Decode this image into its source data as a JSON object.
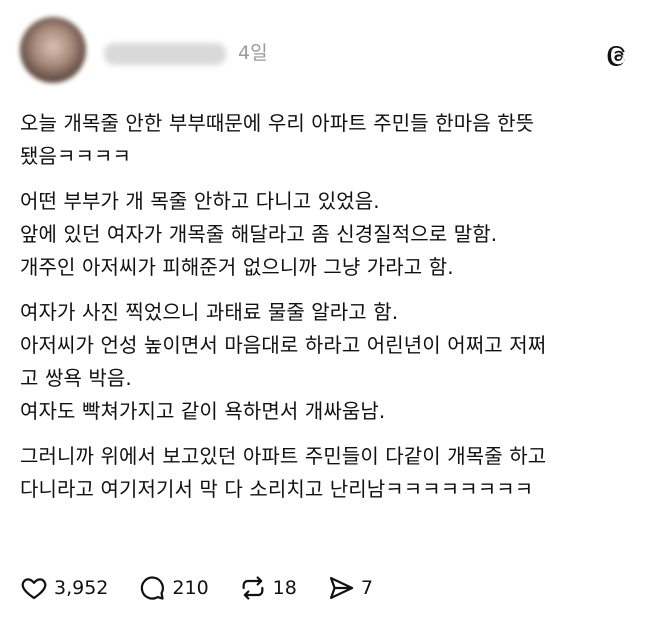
{
  "post": {
    "username": "psleh_ping",
    "time": "4일",
    "paragraphs": [
      [
        "오늘 개목줄 안한 부부때문에 우리 아파트 주민들 한마음 한뜻",
        "됐음ㅋㅋㅋㅋ"
      ],
      [
        "어떤 부부가 개 목줄 안하고 다니고 있었음.",
        "앞에 있던 여자가 개목줄 해달라고 좀 신경질적으로 말함.",
        "개주인 아저씨가 피해준거 없으니까 그냥 가라고 함."
      ],
      [
        "여자가 사진 찍었으니 과태료 물줄 알라고 함.",
        "아저씨가 언성 높이면서 마음대로 하라고 어린년이 어쩌고 저쩌",
        "고 쌍욕 박음.",
        "여자도 빡쳐가지고 같이 욕하면서 개싸움남."
      ],
      [
        "그러니까 위에서 보고있던 아파트 주민들이 다같이 개목줄 하고",
        "다니라고 여기저기서 막 다 소리치고 난리남ㅋㅋㅋㅋㅋㅋㅋㅋ"
      ]
    ]
  },
  "actions": {
    "like_count": "3,952",
    "reply_count": "210",
    "repost_count": "18",
    "share_count": "7"
  },
  "icons": {
    "logo": "threads-logo-icon",
    "like": "heart-icon",
    "reply": "speech-bubble-icon",
    "repost": "repost-icon",
    "share": "send-icon"
  }
}
